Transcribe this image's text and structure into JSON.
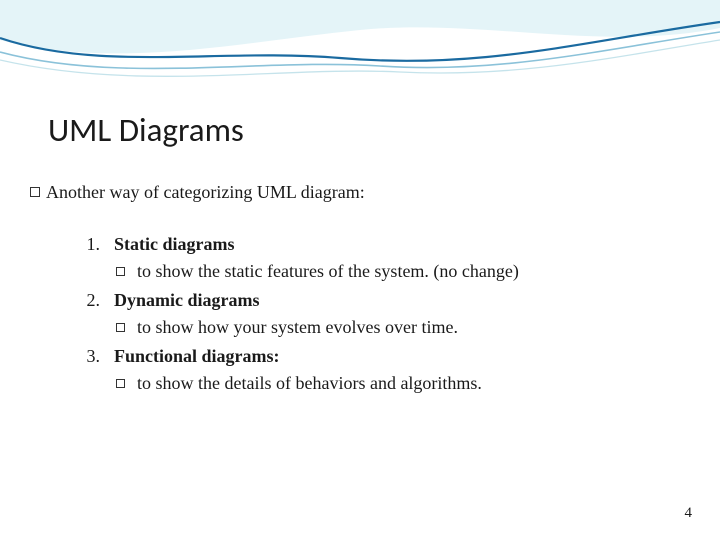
{
  "title": "UML Diagrams",
  "intro": "Another way of categorizing UML diagram:",
  "items": [
    {
      "num": "1.",
      "heading": "Static diagrams",
      "desc": "to show the static features of the system. (no change)"
    },
    {
      "num": "2.",
      "heading": "Dynamic diagrams",
      "desc": "to show how your system evolves over time."
    },
    {
      "num": "3.",
      "heading": "Functional diagrams:",
      "desc": "to show the details of behaviors and algorithms."
    }
  ],
  "pageNumber": "4"
}
